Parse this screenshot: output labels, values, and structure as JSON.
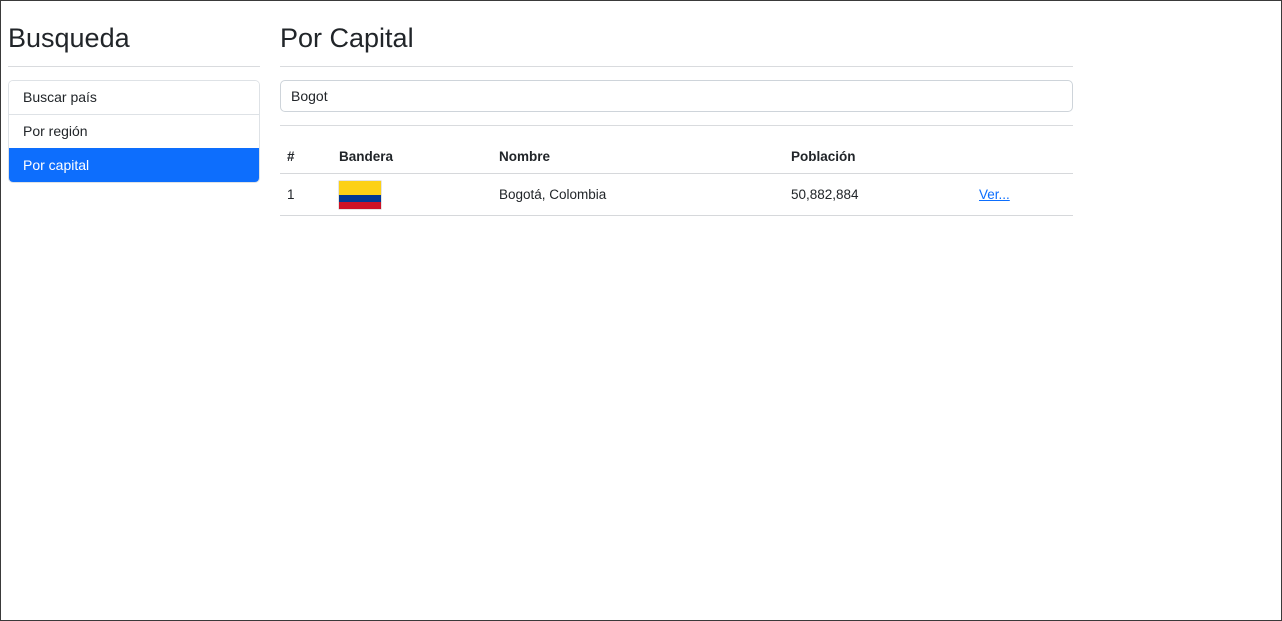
{
  "sidebar": {
    "title": "Busqueda",
    "items": [
      {
        "label": "Buscar país",
        "active": false
      },
      {
        "label": "Por región",
        "active": false
      },
      {
        "label": "Por capital",
        "active": true
      }
    ]
  },
  "main": {
    "title": "Por Capital",
    "search": {
      "value": "Bogot",
      "placeholder": ""
    },
    "table": {
      "headers": {
        "num": "#",
        "flag": "Bandera",
        "name": "Nombre",
        "population": "Población",
        "action": ""
      },
      "rows": [
        {
          "num": "1",
          "flag_icon": "colombia-flag-icon",
          "name": "Bogotá, Colombia",
          "population": "50,882,884",
          "link_label": "Ver..."
        }
      ]
    }
  },
  "colors": {
    "accent": "#0d6efd",
    "flag_colombia": [
      "#fcd116",
      "#003893",
      "#ce1126"
    ]
  }
}
